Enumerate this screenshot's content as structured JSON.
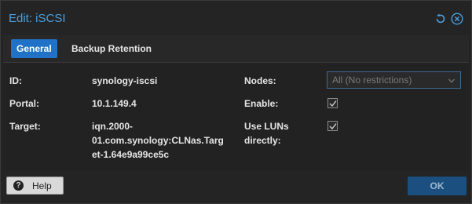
{
  "title": "Edit: iSCSI",
  "tabs": [
    {
      "label": "General"
    },
    {
      "label": "Backup Retention"
    }
  ],
  "fields": {
    "id_label": "ID:",
    "id_value": "synology-iscsi",
    "portal_label": "Portal:",
    "portal_value": "10.1.149.4",
    "target_label": "Target:",
    "target_line1": "iqn.2000-",
    "target_line2": "01.com.synology:CLNas.Targ",
    "target_line3": "et-1.64e9a99ce5c",
    "nodes_label": "Nodes:",
    "nodes_placeholder": "All (No restrictions)",
    "enable_label": "Enable:",
    "enable_checked": true,
    "luns_label_line1": "Use LUNs",
    "luns_label_line2": "directly:",
    "luns_checked": true
  },
  "footer": {
    "help_label": "Help",
    "ok_label": "OK"
  },
  "colors": {
    "accent": "#4a9fe0",
    "tab_active": "#1f72c6",
    "ok_button": "#1a4f80"
  },
  "icons": [
    "reset-icon",
    "close-icon",
    "chevron-down-icon",
    "help-icon",
    "check-icon"
  ]
}
